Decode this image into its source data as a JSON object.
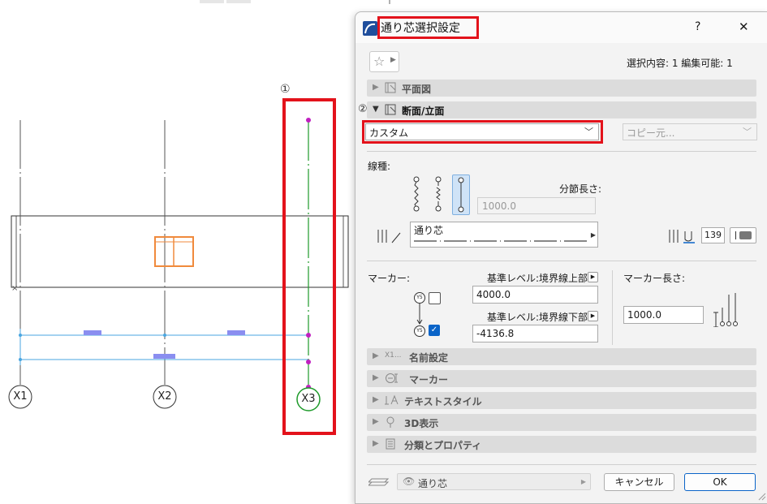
{
  "canvas": {
    "step_marker_1": "①",
    "grid_labels": [
      "X1",
      "X2",
      "X3"
    ]
  },
  "dialog": {
    "title": "通り芯選択設定",
    "help_label": "?",
    "close_label": "✕",
    "selection_info": "選択内容: 1 編集可能: 1",
    "sections": {
      "floor_plan": "平面図",
      "section_elevation": "断面/立面",
      "naming": "名前設定",
      "marker": "マーカー",
      "text_style": "テキストスタイル",
      "view_3d": "3D表示",
      "classification": "分類とプロパティ"
    },
    "step_marker_2": "②",
    "naming_prefix": "X1...",
    "mode_select": "カスタム",
    "copy_from": "コピー元...",
    "line_type_label": "線種:",
    "segment_length_label": "分節長さ:",
    "segment_length_value": "1000.0",
    "line_name": "通り芯",
    "pen_number": "139",
    "marker_label": "マーカー:",
    "marker_symbol": "Y5",
    "upper_ref_label": "基準レベル:境界線上部",
    "upper_value": "4000.0",
    "lower_ref_label": "基準レベル:境界線下部",
    "lower_value": "-4136.8",
    "marker_length_label": "マーカー長さ:",
    "marker_length_value": "1000.0",
    "upper_checked": false,
    "lower_checked": true,
    "layer_name": "通り芯",
    "cancel_label": "キャンセル",
    "ok_label": "OK"
  },
  "colors": {
    "highlight_red": "#e3121b",
    "gridline_green": "#1e9a2a",
    "magenta": "#c020c0",
    "cyan": "#4aa6e0",
    "orange": "#f08a3c",
    "accent_blue": "#0a64c8"
  }
}
